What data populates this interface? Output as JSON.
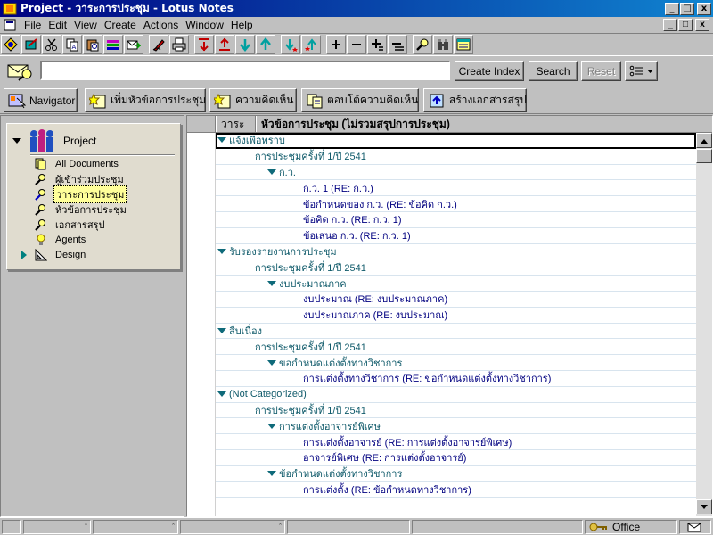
{
  "window": {
    "title": "Project - วาระการประชุม - Lotus Notes",
    "controls": [
      "_",
      "🗗",
      "x"
    ]
  },
  "menu": {
    "items": [
      "File",
      "Edit",
      "View",
      "Create",
      "Actions",
      "Window",
      "Help"
    ]
  },
  "toolbar": {
    "icons": [
      "open-database-icon",
      "edit-document-icon",
      "cut-icon",
      "copy-icon",
      "paste-icon",
      "categorize-icon",
      "forward-icon",
      "signature-icon",
      "print-icon",
      "previous-document-icon",
      "next-document-icon",
      "previous-main-icon",
      "next-main-icon",
      "previous-unread-icon",
      "next-unread-icon",
      "expand-icon",
      "collapse-icon",
      "expand-all-icon",
      "collapse-all-icon",
      "search-icon",
      "binoculars-icon",
      "view-icon"
    ]
  },
  "search": {
    "value": "",
    "create_index_label": "Create Index",
    "search_label": "Search",
    "reset_label": "Reset",
    "options_label": "8≡"
  },
  "actions": [
    {
      "label": "Navigator",
      "icon": "navigator-icon"
    },
    {
      "label": "เพิ่มหัวข้อการประชุม",
      "icon": "new-topic-icon"
    },
    {
      "label": "ความคิดเห็น",
      "icon": "comment-icon"
    },
    {
      "label": "ตอบโต้ความคิดเห็น",
      "icon": "reply-icon"
    },
    {
      "label": "สร้างเอกสารสรุป",
      "icon": "summary-icon"
    }
  ],
  "navigator": {
    "project_label": "Project",
    "items": [
      {
        "label": "All Documents",
        "icon": "all-documents-icon",
        "selected": false
      },
      {
        "label": "ผู้เข้าร่วมประชุม",
        "icon": "view-search-icon",
        "selected": false
      },
      {
        "label": "วาระการประชุม",
        "icon": "view-search-icon",
        "selected": true
      },
      {
        "label": "หัวข้อการประชุม",
        "icon": "view-search-icon",
        "selected": false
      },
      {
        "label": "เอกสารสรุป",
        "icon": "view-search-icon",
        "selected": false
      },
      {
        "label": "Agents",
        "icon": "agents-bulb-icon",
        "selected": false
      },
      {
        "label": "Design",
        "icon": "design-icon",
        "selected": false
      }
    ]
  },
  "view": {
    "columns": [
      "วาระ",
      "หัวข้อการประชุม  (ไม่รวมสรุปการประชุม)"
    ],
    "rows": [
      {
        "level": 0,
        "type": "cat",
        "twistie": true,
        "text": "แจ้งเพื่อทราบ"
      },
      {
        "level": 1,
        "type": "cat",
        "twistie": false,
        "text": "การประชุมครั้งที่ 1/ปี 2541"
      },
      {
        "level": 2,
        "type": "cat",
        "twistie": true,
        "text": "ก.ว."
      },
      {
        "level": 3,
        "type": "doc",
        "twistie": false,
        "text": "ก.ว. 1 (RE: ก.ว.)"
      },
      {
        "level": 3,
        "type": "doc",
        "twistie": false,
        "text": "ข้อกำหนดของ ก.ว.  (RE: ข้อคิด ก.ว.)"
      },
      {
        "level": 3,
        "type": "doc",
        "twistie": false,
        "text": "ข้อคิด ก.ว. (RE: ก.ว. 1)"
      },
      {
        "level": 3,
        "type": "doc",
        "twistie": false,
        "text": "ข้อเสนอ ก.ว.  (RE: ก.ว. 1)"
      },
      {
        "level": 0,
        "type": "cat",
        "twistie": true,
        "text": "รับรองรายงานการประชุม"
      },
      {
        "level": 1,
        "type": "cat",
        "twistie": false,
        "text": "การประชุมครั้งที่ 1/ปี 2541"
      },
      {
        "level": 2,
        "type": "cat",
        "twistie": true,
        "text": "งบประมาณภาค"
      },
      {
        "level": 3,
        "type": "doc",
        "twistie": false,
        "text": "งบประมาณ (RE: งบประมาณภาค)"
      },
      {
        "level": 3,
        "type": "doc",
        "twistie": false,
        "text": "งบประมาณภาค (RE: งบประมาณ)"
      },
      {
        "level": 0,
        "type": "cat",
        "twistie": true,
        "text": "สืบเนื่อง"
      },
      {
        "level": 1,
        "type": "cat",
        "twistie": false,
        "text": "การประชุมครั้งที่ 1/ปี 2541"
      },
      {
        "level": 2,
        "type": "cat",
        "twistie": true,
        "text": "ขอกำหนดแต่งตั้งทางวิชาการ"
      },
      {
        "level": 3,
        "type": "doc",
        "twistie": false,
        "text": "การแต่งตั้งทางวิชาการ (RE: ขอกำหนดแต่งตั้งทางวิชาการ)"
      },
      {
        "level": 0,
        "type": "cat",
        "twistie": true,
        "text": "(Not Categorized)"
      },
      {
        "level": 1,
        "type": "cat",
        "twistie": false,
        "text": "การประชุมครั้งที่ 1/ปี 2541"
      },
      {
        "level": 2,
        "type": "cat",
        "twistie": true,
        "text": "การแต่งตั้งอาจารย์พิเศษ"
      },
      {
        "level": 3,
        "type": "doc",
        "twistie": false,
        "text": "การแต่งตั้งอาจารย์ (RE: การแต่งตั้งอาจารย์พิเศษ)"
      },
      {
        "level": 3,
        "type": "doc",
        "twistie": false,
        "text": "อาจารย์พิเศษ (RE: การแต่งตั้งอาจารย์)"
      },
      {
        "level": 2,
        "type": "cat",
        "twistie": true,
        "text": "ข้อกำหนดแต่งตั้งทางวิชาการ"
      },
      {
        "level": 3,
        "type": "doc",
        "twistie": false,
        "text": "การแต่งตั้ง (RE: ข้อกำหนดทางวิชาการ)"
      }
    ]
  },
  "status": {
    "location": "Office",
    "location_icon": "key-icon"
  },
  "colors": {
    "title_start": "#000080",
    "title_end": "#1084d0",
    "category_text": "#0f5a6a",
    "document_text": "#000080",
    "selected_nav": "#ffff99",
    "panel": "#e0dccf"
  }
}
